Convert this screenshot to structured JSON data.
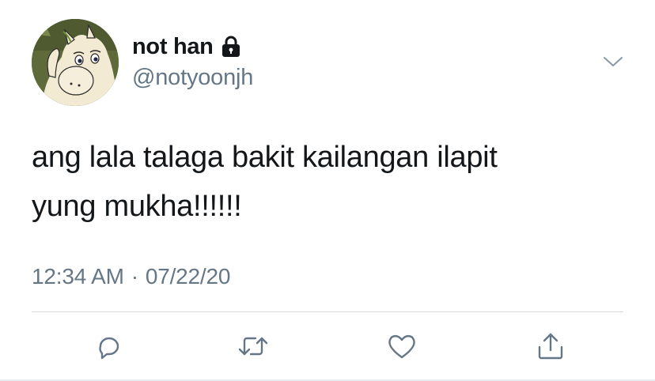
{
  "user": {
    "display_name": "not han",
    "handle": "@notyoonjh",
    "protected_icon": "lock-icon",
    "avatar_icon": "cartoon-avatar"
  },
  "tweet": {
    "text": "ang lala talaga bakit kailangan ilapit\nyung mukha!!!!!!",
    "time": "12:34 AM",
    "separator": "·",
    "date": "07/22/20"
  },
  "actions": [
    {
      "name": "reply",
      "icon": "reply-icon"
    },
    {
      "name": "retweet",
      "icon": "retweet-icon"
    },
    {
      "name": "like",
      "icon": "heart-icon"
    },
    {
      "name": "share",
      "icon": "share-icon"
    }
  ],
  "menu": {
    "icon": "chevron-down-icon"
  },
  "colors": {
    "text": "#14171a",
    "secondary": "#657786",
    "divider": "#d9dde1"
  }
}
